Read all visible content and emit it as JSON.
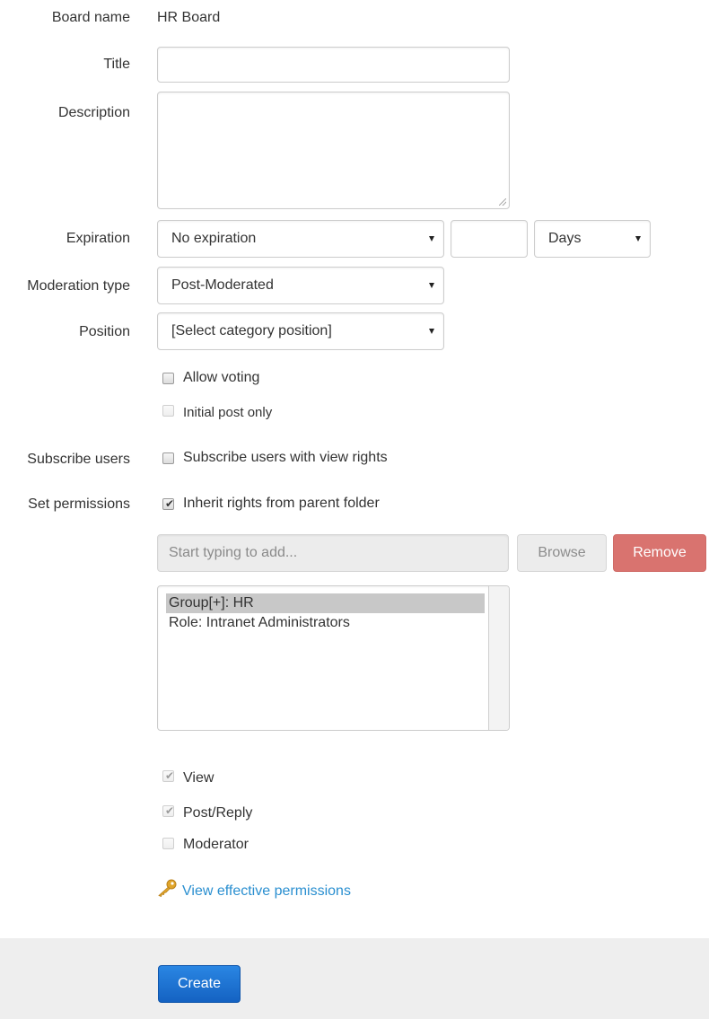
{
  "form": {
    "board_name": {
      "label": "Board name",
      "value": "HR Board"
    },
    "title": {
      "label": "Title",
      "value": ""
    },
    "description": {
      "label": "Description",
      "value": ""
    },
    "expiration": {
      "label": "Expiration",
      "selected": "No expiration",
      "amount_value": "",
      "unit_selected": "Days"
    },
    "moderation_type": {
      "label": "Moderation type",
      "selected": "Post-Moderated"
    },
    "position": {
      "label": "Position",
      "selected": "[Select category position]"
    },
    "allow_voting": {
      "label": "Allow voting",
      "checked": false
    },
    "initial_post_only": {
      "label": "Initial post only",
      "checked": false,
      "disabled": true
    },
    "subscribe_users": {
      "label": "Subscribe users",
      "checkbox_label": "Subscribe users with view rights",
      "checked": false
    },
    "set_permissions": {
      "label": "Set permissions",
      "checkbox_label": "Inherit rights from parent folder",
      "checked": true
    }
  },
  "permissions": {
    "search_placeholder": "Start typing to add...",
    "browse_label": "Browse",
    "remove_label": "Remove",
    "principals": [
      {
        "text": "Group[+]: HR",
        "selected": true
      },
      {
        "text": "Role: Intranet Administrators",
        "selected": false
      }
    ],
    "rights": [
      {
        "label": "View",
        "checked": true,
        "disabled": true
      },
      {
        "label": "Post/Reply",
        "checked": true,
        "disabled": true
      },
      {
        "label": "Moderator",
        "checked": false,
        "disabled": true
      }
    ],
    "effective_link": "View effective permissions"
  },
  "footer": {
    "create_label": "Create"
  },
  "colors": {
    "remove_button": "#d9736f",
    "create_button": "#1a6fcf",
    "link": "#2a8fd0",
    "selected_row": "#c8c8c8",
    "footer_bg": "#eeeeee",
    "key_icon": "#e0a52a"
  },
  "icons": {
    "effective_permissions": "key-icon"
  }
}
